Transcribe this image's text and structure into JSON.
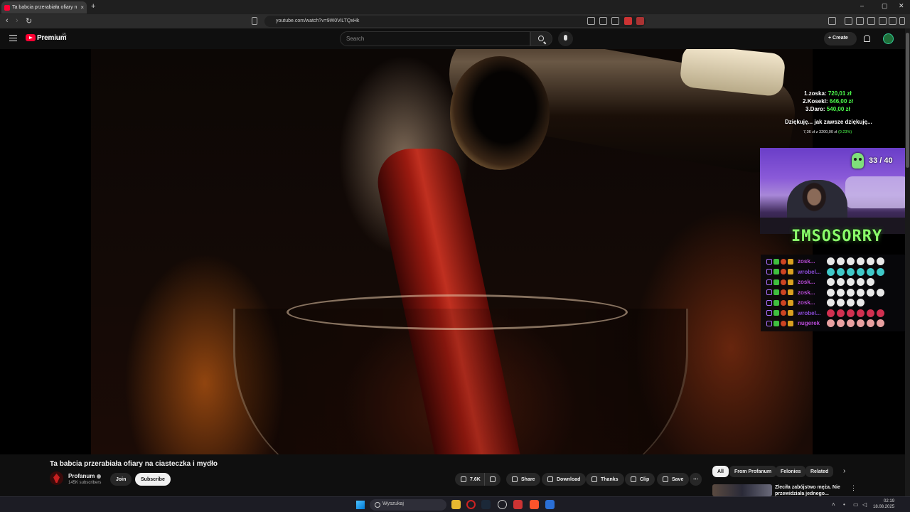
{
  "browser": {
    "tab_title": "Ta babcia przerabiała ofiary n",
    "tab_close": "×",
    "new_tab": "+",
    "url": "youtube.com/watch?v=9W0ViLTQxHk",
    "window_controls": [
      "–",
      "▢",
      "✕"
    ],
    "nav": {
      "back": "‹",
      "forward": "›",
      "reload": "↻"
    }
  },
  "youtube": {
    "logo_text": "Premium",
    "logo_sup": "PL",
    "search_placeholder": "Search",
    "create_label": "+ Create"
  },
  "overlay": {
    "leaderboard": [
      {
        "rank": "1.",
        "name": "zoska:",
        "amount": "720,01 zł"
      },
      {
        "rank": "2.",
        "name": "Kosekl:",
        "amount": "646,00 zł"
      },
      {
        "rank": "3.",
        "name": "Daro:",
        "amount": "540,00 zł"
      }
    ],
    "goal_text": "Dziękuję... jak zawsze dziękuję...",
    "goal_progress": "7,36 zł z 3200,00 zł",
    "goal_percent": "(0.23%)",
    "counter": "33 / 40",
    "banner": "IMSOSORRY",
    "chat": [
      {
        "name": "zosk...",
        "color": "#b84bd6",
        "emote_color": "#e8e8e8",
        "emotes": 6
      },
      {
        "name": "wrobel...",
        "color": "#8a4bd6",
        "emote_color": "#3fc8c8",
        "emotes": 6
      },
      {
        "name": "zosk...",
        "color": "#b84bd6",
        "emote_color": "#e8e8e8",
        "emotes": 5
      },
      {
        "name": "zosk...",
        "color": "#b84bd6",
        "emote_color": "#e8e8e8",
        "emotes": 6
      },
      {
        "name": "zosk...",
        "color": "#b84bd6",
        "emote_color": "#e8e8e8",
        "emotes": 4
      },
      {
        "name": "wrobel...",
        "color": "#8a4bd6",
        "emote_color": "#d03050",
        "emotes": 6
      },
      {
        "name": "nugerek",
        "color": "#b84bd6",
        "emote_color": "#e8a0a0",
        "emotes": 6
      }
    ]
  },
  "video": {
    "title": "Ta babcia przerabiała ofiary na ciasteczka i mydło",
    "channel": "Profanum",
    "subscribers": "145K subscribers",
    "join": "Join",
    "subscribe": "Subscribe",
    "likes": "7.6K",
    "share": "Share",
    "download": "Download",
    "thanks": "Thanks",
    "clip": "Clip",
    "save": "Save",
    "more": "⋯"
  },
  "sidebar": {
    "chips": [
      "All",
      "From Profanum",
      "Felonies",
      "Related"
    ],
    "chip_next": "›",
    "rec_title": "Zleciła zabójstwo męża. Nie przewidziała jednego...",
    "rec_menu": "⋮"
  },
  "taskbar": {
    "search": "Wyszukaj",
    "time": "02:19",
    "date": "18.08.2025"
  }
}
